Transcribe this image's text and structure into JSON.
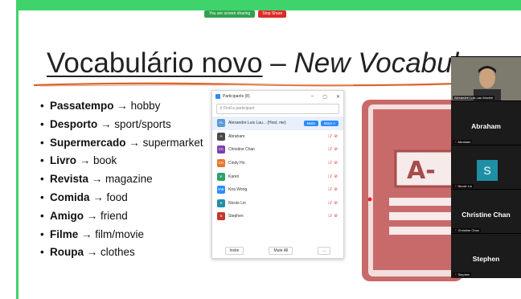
{
  "share_bar": {
    "sharing_text": "You are screen sharing",
    "stop_label": "Stop Share"
  },
  "slide": {
    "title_pt": "Vocabulário novo",
    "title_dash": " – ",
    "title_en": "New Vocabulary",
    "items": [
      {
        "pt": "Passatempo",
        "en": "hobby"
      },
      {
        "pt": "Desporto",
        "en": "sport/sports"
      },
      {
        "pt": "Supermercado",
        "en": "supermarket"
      },
      {
        "pt": "Livro",
        "en": "book"
      },
      {
        "pt": "Revista",
        "en": "magazine"
      },
      {
        "pt": "Comida",
        "en": "food"
      },
      {
        "pt": "Amigo",
        "en": "friend"
      },
      {
        "pt": "Filme",
        "en": "film/movie"
      },
      {
        "pt": "Roupa",
        "en": "clothes"
      }
    ],
    "arrow": "→",
    "bullet": "•"
  },
  "participants": {
    "title": "Participants (8)",
    "search_placeholder": "Find a participant",
    "host": {
      "initials": "AL",
      "name": "Alexandre Luis Lau... (Host, me)",
      "mute": "Mute",
      "more": "More >"
    },
    "list": [
      {
        "initials": "A",
        "name": "Abraham",
        "color": "#4a4a4a"
      },
      {
        "initials": "CC",
        "name": "Christine Chan",
        "color": "#7a3fb0"
      },
      {
        "initials": "CH",
        "name": "Cindy Ho",
        "color": "#e8762b"
      },
      {
        "initials": "K",
        "name": "Karen",
        "color": "#2aa36b"
      },
      {
        "initials": "KW",
        "name": "Kira Wong",
        "color": "#2d8cff"
      },
      {
        "initials": "S",
        "name": "Nicole Lin",
        "color": "#1f8fa6"
      },
      {
        "initials": "S",
        "name": "Stephen",
        "color": "#c0392b"
      }
    ],
    "footer": {
      "invite": "Invite",
      "mute_all": "Mute All",
      "more": "..."
    }
  },
  "gallery": [
    {
      "name": "",
      "label": "Alexandre Luis Lau Mochel",
      "type": "camera"
    },
    {
      "name": "Abraham",
      "label": "Abraham",
      "type": "name"
    },
    {
      "name": "S",
      "label": "Nicole Lin",
      "type": "avatar"
    },
    {
      "name": "Christine Chan",
      "label": "Christine Chan",
      "type": "name"
    },
    {
      "name": "Stephen",
      "label": "Stephen",
      "type": "name"
    }
  ],
  "colors": {
    "accent_green": "#3fd36c",
    "book_red": "#c96a6a",
    "brush_orange": "#d9632b"
  }
}
